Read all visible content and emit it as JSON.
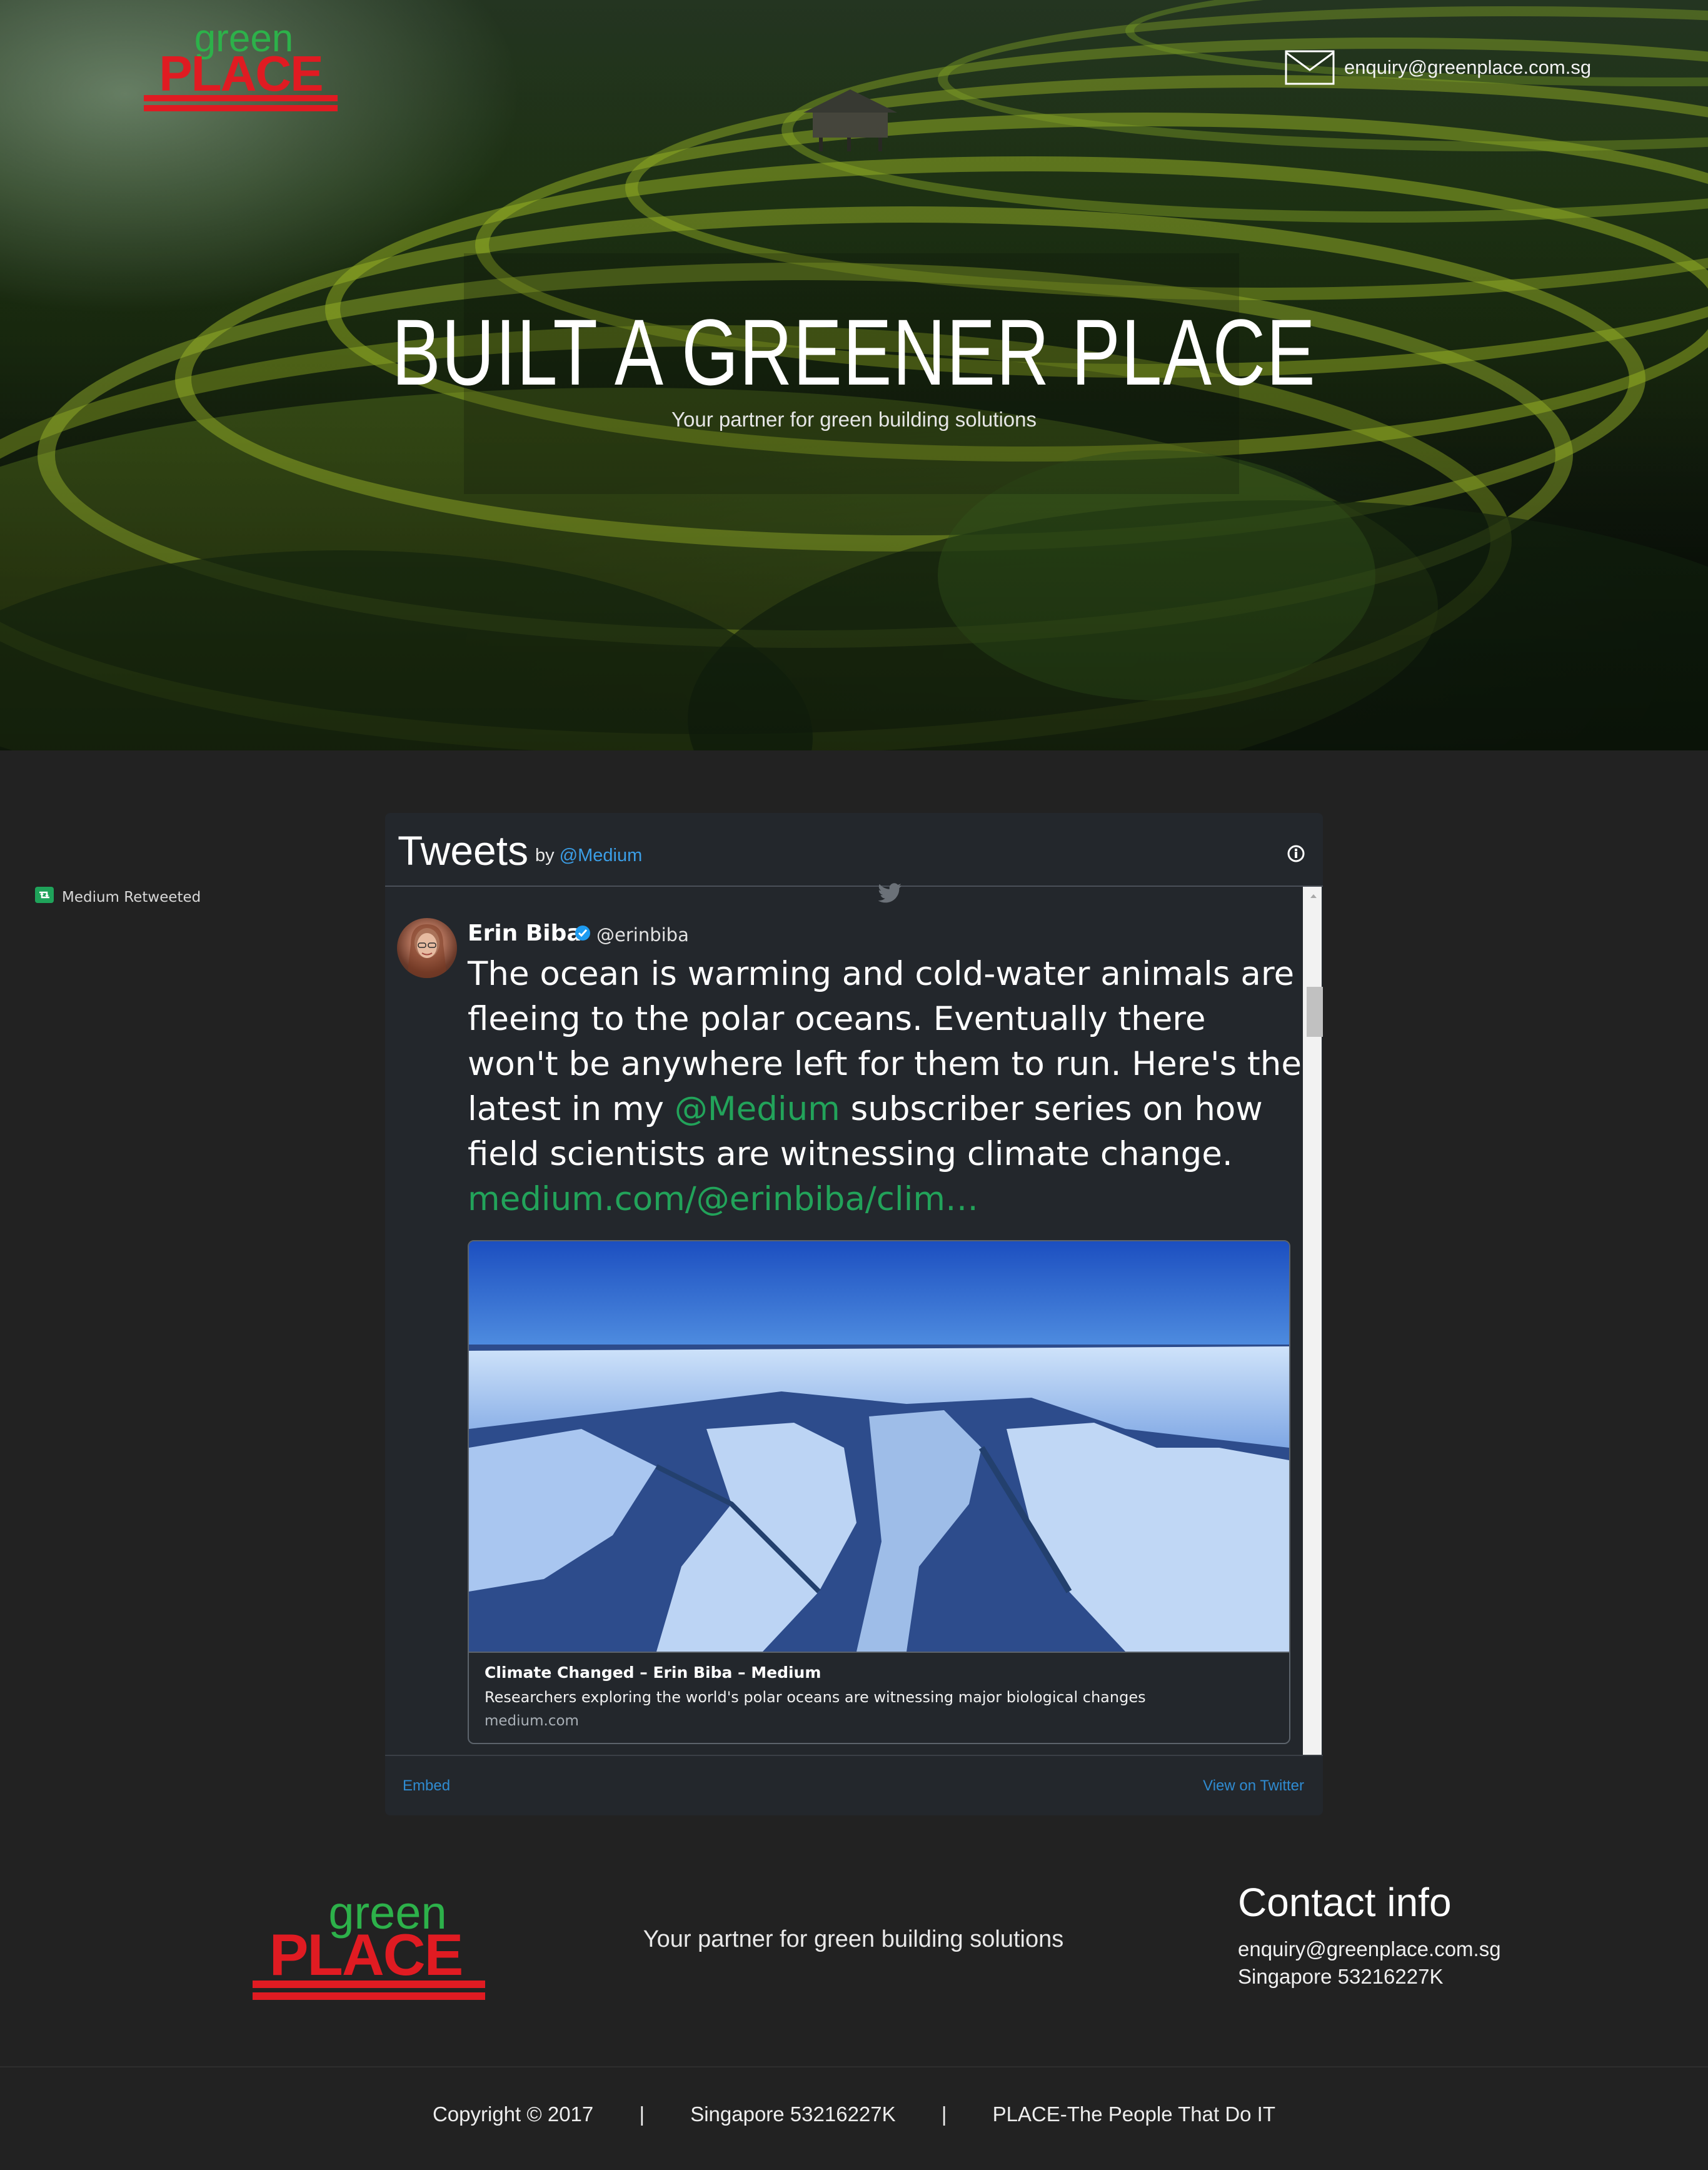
{
  "header": {
    "logo_top_text": "green",
    "logo_bottom_text": "PLACE",
    "email": "enquiry@greenplace.com.sg"
  },
  "hero": {
    "title": "BUILT A GREENER PLACE",
    "subtitle": "Your partner for green building solutions"
  },
  "twitter_widget": {
    "title": "Tweets",
    "by_label": "by",
    "by_handle": "@Medium",
    "retweet_label": "Medium Retweeted",
    "author_name": "Erin Biba",
    "author_handle": "@erinbiba",
    "tweet_part1": "The ocean is warming and cold-water animals are fleeing to the polar oceans. Eventually there won't be anywhere left for them to run. Here's the latest in my",
    "tweet_mention": "@Medium",
    "tweet_part2": "subscriber series on how field scientists are witnessing climate change.",
    "tweet_link": "medium.com/@erinbiba/clim…",
    "card_title": "Climate Changed – Erin Biba – Medium",
    "card_description": "Researchers exploring the world's polar oceans are witnessing major biological changes",
    "card_domain": "medium.com",
    "embed_label": "Embed",
    "view_label": "View on Twitter"
  },
  "footer": {
    "tagline": "Your partner for green building solutions",
    "contact_title": "Contact info",
    "contact_email": "enquiry@greenplace.com.sg",
    "contact_phone": "Singapore 53216227K",
    "copyright": "Copyright © 2017",
    "divider": "|",
    "company_reg": "Singapore 53216227K",
    "slogan": "PLACE-The People That Do IT"
  },
  "colors": {
    "brand_green": "#2db14a",
    "brand_red": "#e01b22",
    "link_blue": "#2f8bd1",
    "tweet_link_green": "#22a35a",
    "page_bg": "#222222",
    "widget_bg": "#23272c"
  },
  "icons": [
    "mail-icon",
    "info-icon",
    "retweet-icon",
    "twitter-bird-icon",
    "verified-icon"
  ]
}
